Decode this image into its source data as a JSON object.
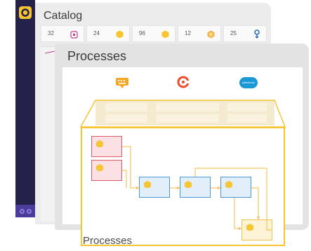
{
  "colors": {
    "sidebar": "#24214a",
    "accent_yellow": "#f7c531",
    "red": "#e25a67",
    "blue": "#4b95d1"
  },
  "catalog": {
    "title": "Catalog",
    "tiles": [
      {
        "count": "32",
        "icon": "pink-square-icon"
      },
      {
        "count": "24",
        "icon": "yellow-hexagon-icon"
      },
      {
        "count": "96",
        "icon": "yellow-hexagon-icon"
      },
      {
        "count": "12",
        "icon": "orange-hexagon-icon"
      },
      {
        "count": "25",
        "icon": "blue-pin-icon"
      }
    ]
  },
  "processes": {
    "title": "Processes",
    "integrations": [
      "keyboard-icon",
      "coupa-logo",
      "salesforce-logo"
    ],
    "salesforce_text": "salesforce"
  },
  "footer": {
    "label": "Processes"
  }
}
